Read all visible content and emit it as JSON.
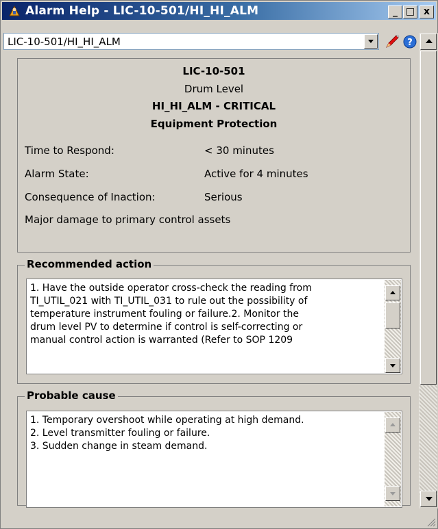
{
  "window": {
    "title": "Alarm Help - LIC-10-501/HI_HI_ALM",
    "minimize": "_",
    "maximize": "□",
    "close": "x"
  },
  "selector": {
    "value": "LIC-10-501/HI_HI_ALM"
  },
  "summary": {
    "tag": "LIC-10-501",
    "description": "Drum Level",
    "alarm": "HI_HI_ALM - CRITICAL",
    "category": "Equipment Protection",
    "rows": [
      {
        "label": "Time to Respond:",
        "value": "< 30 minutes"
      },
      {
        "label": "Alarm State:",
        "value": "Active for 4 minutes"
      },
      {
        "label": "Consequence of Inaction:",
        "value": "Serious"
      }
    ],
    "consequence_detail": "Major damage to primary control assets"
  },
  "recommended_action": {
    "title": "Recommended action",
    "lines": [
      "1.  Have the outside operator cross-check the reading from",
      "TI_UTIL_021 with TI_UTIL_031 to rule out the possibility of",
      "temperature instrument fouling or failure.2.  Monitor the",
      "drum level PV to determine if control is self-correcting or",
      "manual control action is warranted (Refer to SOP 1209"
    ]
  },
  "probable_cause": {
    "title": "Probable cause",
    "lines": [
      "1.  Temporary overshoot while operating at high demand.",
      "2.  Level transmitter fouling or failure.",
      "3.  Sudden change in steam demand."
    ]
  },
  "icons": {
    "title": "alarm-help-app-icon",
    "edit": "pencil-icon",
    "help": "help-icon"
  },
  "colors": {
    "titlebar_start": "#0a246a",
    "titlebar_end": "#a6caf0",
    "face": "#d4d0c8"
  }
}
